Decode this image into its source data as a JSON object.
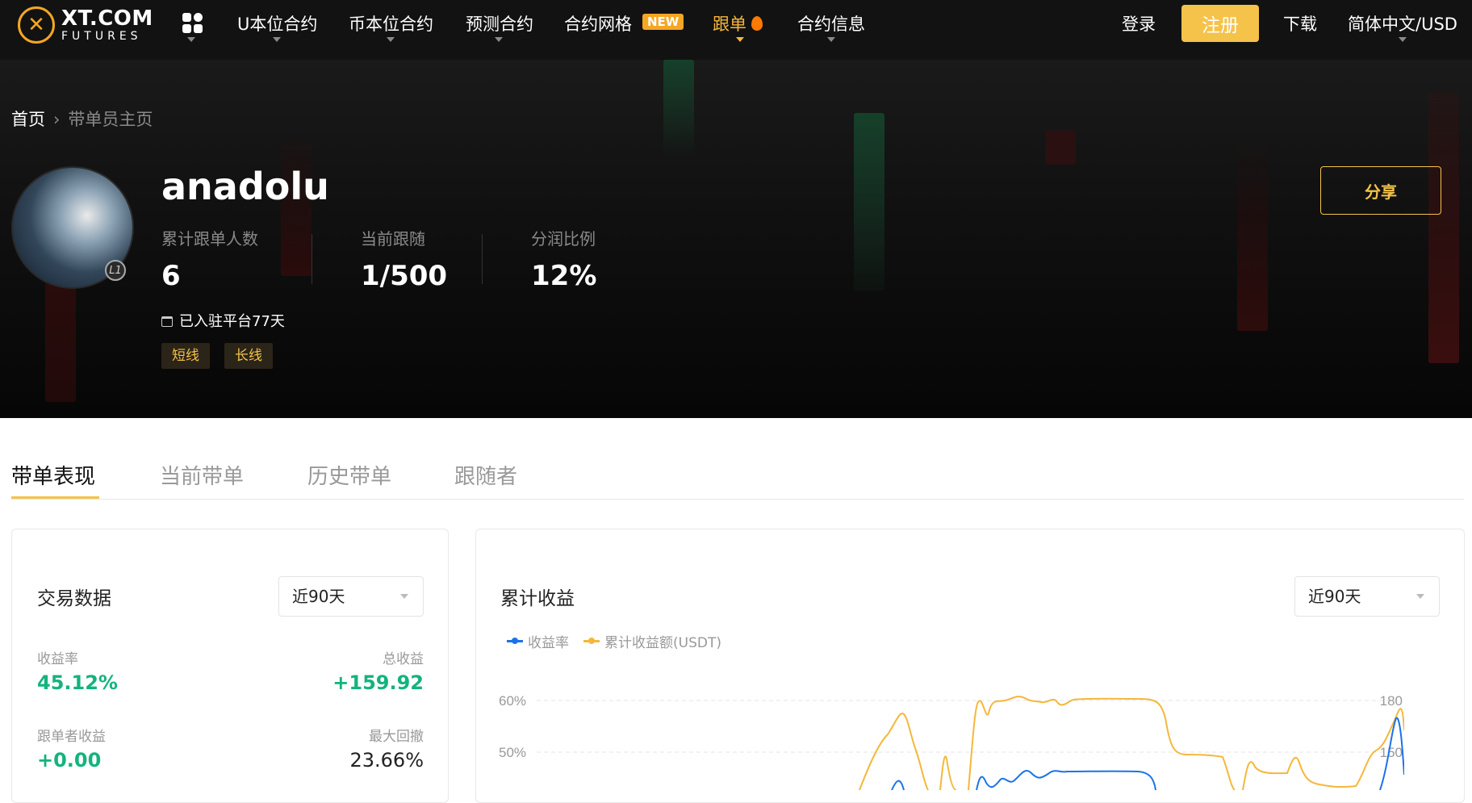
{
  "nav": {
    "logo_main": "XT.COM",
    "logo_sub": "FUTURES",
    "items": [
      "U本位合约",
      "币本位合约",
      "预测合约",
      "合约网格",
      "跟单",
      "合约信息"
    ],
    "new_badge": "NEW",
    "login": "登录",
    "register": "注册",
    "download": "下载",
    "language": "简体中文/USD",
    "accent": "#f5c24a"
  },
  "breadcrumb": {
    "home": "首页",
    "current": "带单员主页"
  },
  "trader": {
    "name": "anadolu",
    "level": "L1",
    "stats": [
      {
        "label": "累计跟单人数",
        "value": "6"
      },
      {
        "label": "当前跟随",
        "value": "1/500"
      },
      {
        "label": "分润比例",
        "value": "12%"
      }
    ],
    "joined": "已入驻平台77天",
    "tags": [
      "短线",
      "长线"
    ],
    "share": "分享"
  },
  "tabs": [
    "带单表现",
    "当前带单",
    "历史带单",
    "跟随者"
  ],
  "trading_card": {
    "title": "交易数据",
    "period": "近90天",
    "metrics": [
      {
        "label": "收益率",
        "value": "45.12%"
      },
      {
        "label": "总收益",
        "value": "+159.92"
      },
      {
        "label": "跟单者收益",
        "value": "+0.00"
      },
      {
        "label": "最大回撤",
        "value": "23.66%"
      }
    ]
  },
  "earnings_card": {
    "title": "累计收益",
    "period": "近90天",
    "legend": [
      "收益率",
      "累计收益额(USDT)"
    ]
  },
  "chart_data": {
    "type": "line",
    "series": [
      {
        "name": "收益率",
        "color": "#1a73e8"
      },
      {
        "name": "累计收益额(USDT)",
        "color": "#f5b73b"
      }
    ],
    "y_left_ticks": [
      "60%",
      "50%"
    ],
    "y_right_ticks": [
      "180",
      "150"
    ],
    "grid": true
  }
}
